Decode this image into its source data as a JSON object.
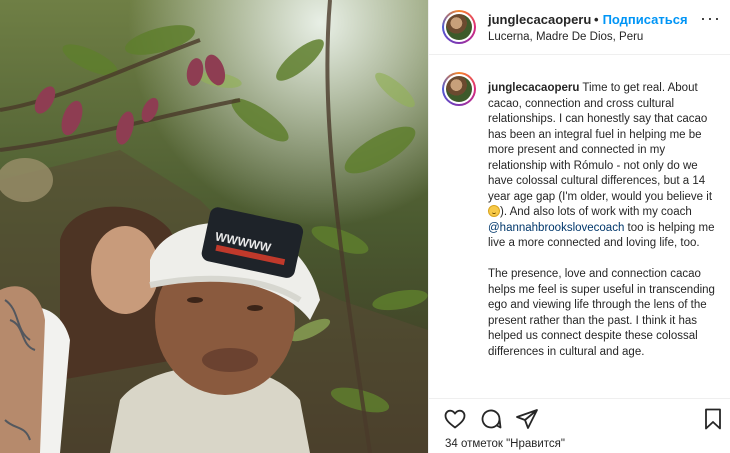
{
  "header": {
    "username": "junglecacaoperu",
    "dot": "•",
    "follow_label": "Подписаться",
    "location": "Lucerna, Madre De Dios, Peru",
    "more_label": "···"
  },
  "caption": {
    "username": "junglecacaoperu",
    "p1_a": "Time to get real. About cacao, connection and cross cultural relationships. I can honestly say that cacao has been an integral fuel in helping me be more present and connected in my relationship with Rómulo - not only do we have colossal cultural differences, but a 14 year age gap (I'm older, would you believe it ",
    "p1_b": "). And also lots of work with my coach ",
    "mention": "@hannahbrookslovecoach",
    "p1_c": " too is helping me live a more connected and loving life, too.",
    "p2": "The presence, love and connection cacao helps me feel is super useful in transcending ego and viewing life through the lens of the present rather than the past. I think it has helped us connect despite these colossal differences in cultural and age."
  },
  "footer": {
    "likes_text": "34 отметок \"Нравится\""
  },
  "icons": {
    "more": "more-options-icon",
    "like": "heart-icon",
    "comment": "comment-icon",
    "share": "share-icon",
    "save": "bookmark-icon",
    "emoji": "smiling-face-emoji"
  },
  "colors": {
    "follow": "#0095f6",
    "mention": "#00376b",
    "text": "#262626",
    "divider": "#efefef"
  }
}
